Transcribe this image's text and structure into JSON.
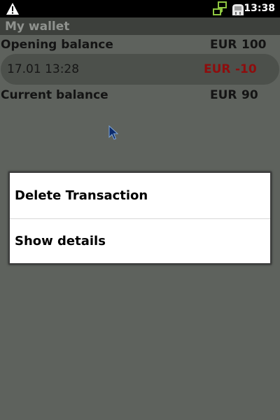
{
  "status_bar": {
    "time": "13:38",
    "icons": [
      "warning-icon",
      "network-icon",
      "usb-icon"
    ]
  },
  "app": {
    "title": "My wallet"
  },
  "balances": {
    "opening": {
      "label": "Opening balance",
      "currency": "EUR",
      "amount": "100"
    },
    "current": {
      "label": "Current balance",
      "currency": "EUR",
      "amount": "90"
    }
  },
  "transactions": [
    {
      "date": "17.01 13:28",
      "currency": "EUR",
      "amount": "-10",
      "color": "#8e0d0d"
    }
  ],
  "context_menu": {
    "items": [
      {
        "label": "Delete Transaction"
      },
      {
        "label": "Show details"
      }
    ]
  },
  "colors": {
    "background": "#5e625d",
    "status_bar": "#000000",
    "title_bar": "#3d403c",
    "negative_amount": "#8e0d0d",
    "menu_background": "#ffffff"
  }
}
